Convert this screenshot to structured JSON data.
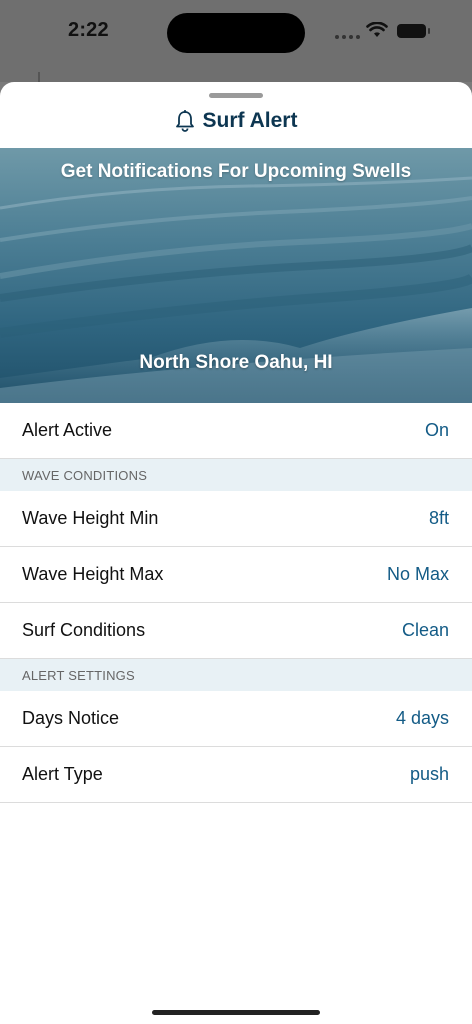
{
  "status_bar": {
    "time": "2:22"
  },
  "sheet": {
    "title": "Surf Alert",
    "title_icon": "bell-icon"
  },
  "hero": {
    "heading": "Get Notifications For Upcoming Swells",
    "location": "North Shore Oahu, HI"
  },
  "alert_active": {
    "label": "Alert Active",
    "value": "On"
  },
  "wave_conditions": {
    "header": "WAVE CONDITIONS",
    "rows": [
      {
        "label": "Wave Height Min",
        "value": "8ft"
      },
      {
        "label": "Wave Height Max",
        "value": "No Max"
      },
      {
        "label": "Surf Conditions",
        "value": "Clean"
      }
    ]
  },
  "alert_settings": {
    "header": "ALERT SETTINGS",
    "rows": [
      {
        "label": "Days Notice",
        "value": "4 days"
      },
      {
        "label": "Alert Type",
        "value": "push"
      }
    ]
  },
  "colors": {
    "title": "#0d3651",
    "value": "#135b86",
    "section_bg": "#e8f1f5"
  }
}
